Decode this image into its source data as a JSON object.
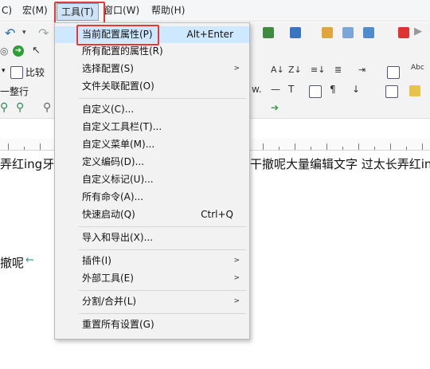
{
  "menubar": {
    "items": [
      {
        "label": "C)"
      },
      {
        "label": "宏(M)"
      },
      {
        "label": "工具(T)"
      },
      {
        "label": "窗口(W)"
      },
      {
        "label": "帮助(H)"
      }
    ]
  },
  "toolbar": {
    "compare_label": "比较",
    "row_label": "一整行"
  },
  "editor": {
    "line1_left": "弄红ing牙扌",
    "line1_right": "干撤呢大量编辑文字 过太长弄红in",
    "line2": "撤呢",
    "line2_mark": "←"
  },
  "menu": {
    "items": [
      {
        "label": "当前配置属性(P)",
        "shortcut": "Alt+Enter",
        "arrow": ""
      },
      {
        "label": "所有配置的属性(R)",
        "shortcut": "",
        "arrow": ""
      },
      {
        "label": "选择配置(S)",
        "shortcut": "",
        "arrow": ">"
      },
      {
        "label": "文件关联配置(O)",
        "shortcut": "",
        "arrow": ""
      },
      {
        "label": "自定义(C)...",
        "shortcut": "",
        "arrow": ""
      },
      {
        "label": "自定义工具栏(T)...",
        "shortcut": "",
        "arrow": ""
      },
      {
        "label": "自定义菜单(M)...",
        "shortcut": "",
        "arrow": ""
      },
      {
        "label": "定义编码(D)...",
        "shortcut": "",
        "arrow": ""
      },
      {
        "label": "自定义标记(U)...",
        "shortcut": "",
        "arrow": ""
      },
      {
        "label": "所有命令(A)...",
        "shortcut": "",
        "arrow": ""
      },
      {
        "label": "快速启动(Q)",
        "shortcut": "Ctrl+Q",
        "arrow": ""
      },
      {
        "label": "导入和导出(X)...",
        "shortcut": "",
        "arrow": ""
      },
      {
        "label": "插件(I)",
        "shortcut": "",
        "arrow": ">"
      },
      {
        "label": "外部工具(E)",
        "shortcut": "",
        "arrow": ">"
      },
      {
        "label": "分割/合并(L)",
        "shortcut": "",
        "arrow": ">"
      },
      {
        "label": "重置所有设置(G)",
        "shortcut": "",
        "arrow": ""
      }
    ]
  },
  "colors": {
    "highlight_border": "#e53935",
    "menu_bg": "#f2f2f2",
    "active_menu_bg": "#cfe3f7"
  }
}
